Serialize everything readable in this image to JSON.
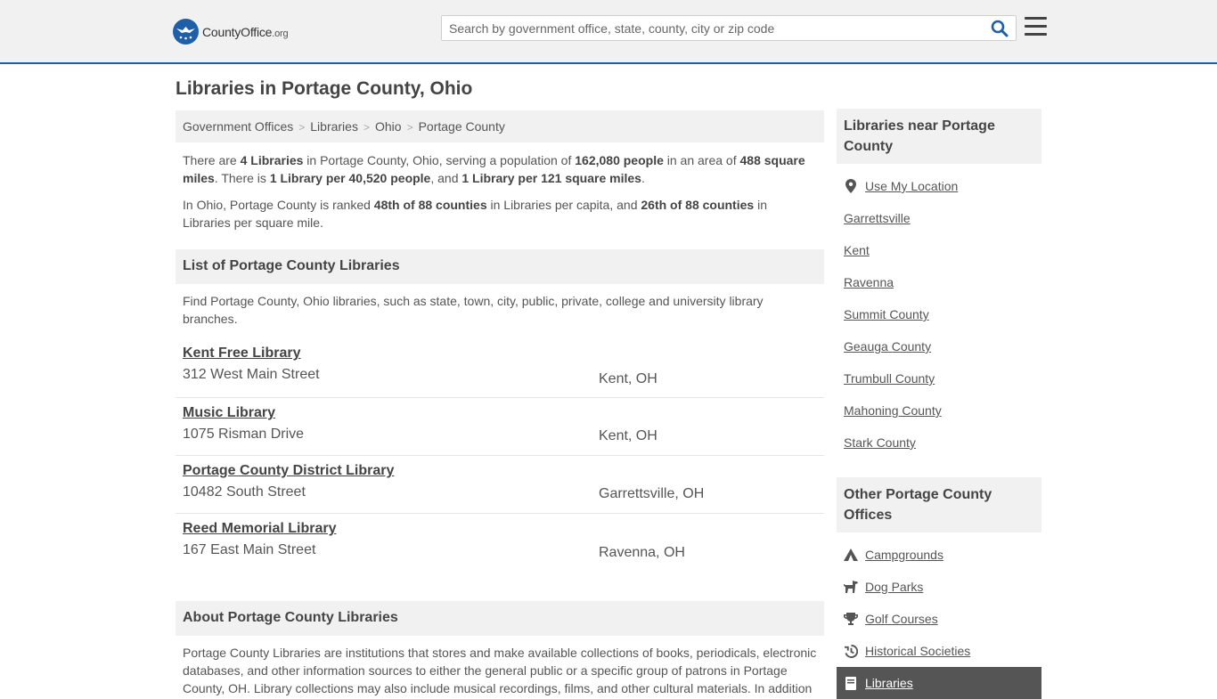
{
  "header": {
    "logo_main": "CountyOffice",
    "logo_tld": ".org",
    "search_placeholder": "Search by government office, state, county, city or zip code"
  },
  "page_title": "Libraries in Portage County, Ohio",
  "breadcrumb": [
    "Government Offices",
    "Libraries",
    "Ohio",
    "Portage County"
  ],
  "summary": {
    "p1": [
      {
        "t": "There are "
      },
      {
        "t": "4 Libraries",
        "b": true
      },
      {
        "t": " in Portage County, Ohio, serving a population of "
      },
      {
        "t": "162,080 people",
        "b": true
      },
      {
        "t": " in an area of "
      },
      {
        "t": "488 square miles",
        "b": true
      },
      {
        "t": ". There is "
      },
      {
        "t": "1 Library per 40,520 people",
        "b": true
      },
      {
        "t": ", and "
      },
      {
        "t": "1 Library per 121 square miles",
        "b": true
      },
      {
        "t": "."
      }
    ],
    "p2": [
      {
        "t": "In Ohio, Portage County is ranked "
      },
      {
        "t": "48th of 88 counties",
        "b": true
      },
      {
        "t": " in Libraries per capita, and "
      },
      {
        "t": "26th of 88 counties",
        "b": true
      },
      {
        "t": " in Libraries per square mile."
      }
    ]
  },
  "list_section": {
    "heading": "List of Portage County Libraries",
    "description": "Find Portage County, Ohio libraries, such as state, town, city, public, private, college and university library branches.",
    "items": [
      {
        "name": "Kent Free Library",
        "address": "312 West Main Street",
        "city": "Kent, OH"
      },
      {
        "name": "Music Library",
        "address": "1075 Risman Drive",
        "city": "Kent, OH"
      },
      {
        "name": "Portage County District Library",
        "address": "10482 South Street",
        "city": "Garrettsville, OH"
      },
      {
        "name": "Reed Memorial Library",
        "address": "167 East Main Street",
        "city": "Ravenna, OH"
      }
    ]
  },
  "about_section": {
    "heading": "About Portage County Libraries",
    "text": "Portage County Libraries are institutions that stores and make available collections of books, periodicals, electronic databases, and other information sources to either the general public or a specific group of patrons in Portage County, OH. Library collections may also include musical recordings, films, and other cultural materials. In addition"
  },
  "sidebar_near": {
    "heading": "Libraries near Portage County",
    "use_location": "Use My Location",
    "links": [
      "Garrettsville",
      "Kent",
      "Ravenna",
      "Summit County",
      "Geauga County",
      "Trumbull County",
      "Mahoning County",
      "Stark County"
    ]
  },
  "sidebar_other": {
    "heading": "Other Portage County Offices",
    "links": [
      {
        "label": "Campgrounds",
        "icon": "campground-icon"
      },
      {
        "label": "Dog Parks",
        "icon": "dog-icon"
      },
      {
        "label": "Golf Courses",
        "icon": "trophy-icon"
      },
      {
        "label": "Historical Societies",
        "icon": "history-icon"
      },
      {
        "label": "Libraries",
        "icon": "book-icon",
        "active": true
      }
    ]
  },
  "colors": {
    "brand": "#1e5fa8",
    "panel": "#f1f1f1",
    "text": "#555555",
    "active": "#555555"
  }
}
